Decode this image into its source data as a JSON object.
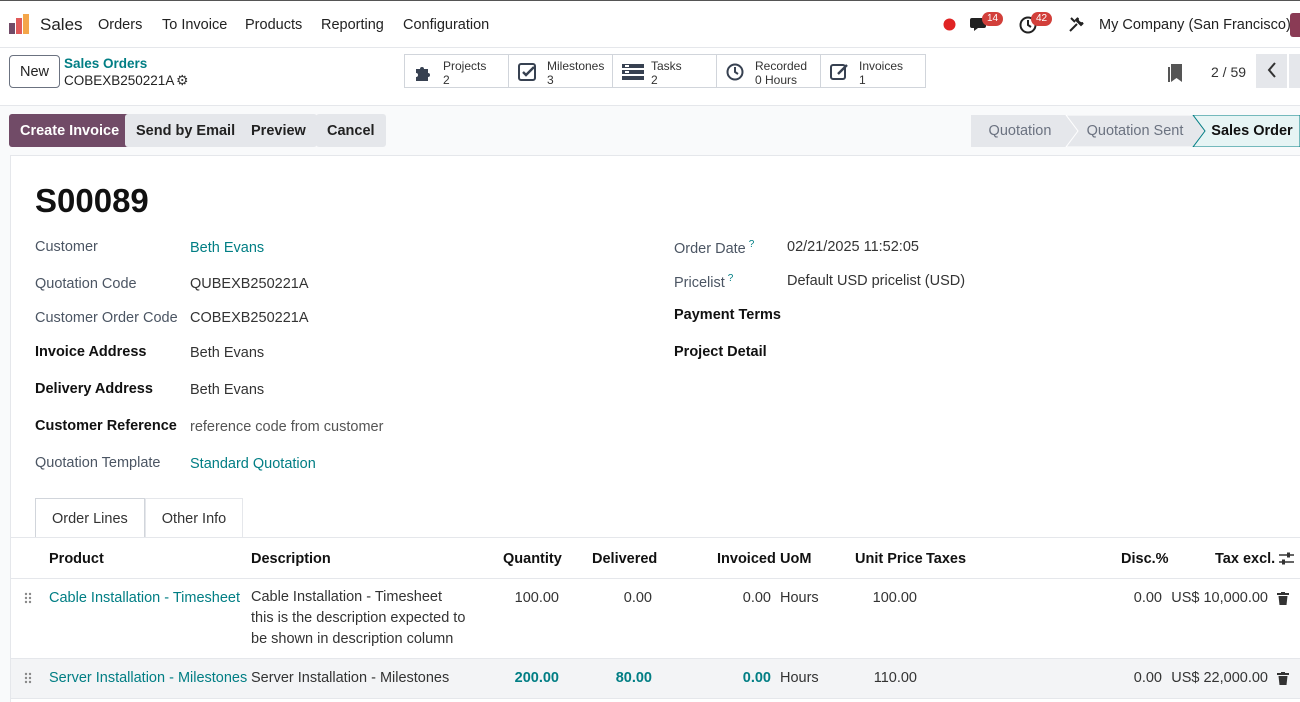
{
  "topnav": {
    "app_name": "Sales",
    "menu": [
      "Orders",
      "To Invoice",
      "Products",
      "Reporting",
      "Configuration"
    ],
    "messages_count": "14",
    "activities_count": "42",
    "company": "My Company (San Francisco)"
  },
  "control": {
    "new_label": "New",
    "breadcrumb": "Sales Orders",
    "record_code": "COBEXB250221A",
    "smart_buttons": [
      {
        "label": "Projects",
        "value": "2",
        "icon": "puzzle-icon"
      },
      {
        "label": "Milestones",
        "value": "3",
        "icon": "check-square-icon"
      },
      {
        "label": "Tasks",
        "value": "2",
        "icon": "tasks-icon"
      },
      {
        "label": "Recorded",
        "value": "0 Hours",
        "icon": "clock-icon"
      },
      {
        "label": "Invoices",
        "value": "1",
        "icon": "invoice-edit-icon"
      }
    ],
    "pager": "2 / 59"
  },
  "actions": {
    "create_invoice": "Create Invoice",
    "send_email": "Send by Email",
    "preview": "Preview",
    "cancel": "Cancel"
  },
  "stages": [
    "Quotation",
    "Quotation Sent",
    "Sales Order"
  ],
  "form": {
    "title": "S00089",
    "left": [
      {
        "label": "Customer",
        "value": "Beth Evans"
      },
      {
        "label": "Quotation Code",
        "value": "QUBEXB250221A"
      },
      {
        "label": "Customer Order Code",
        "value": "COBEXB250221A"
      },
      {
        "label": "Invoice Address",
        "value": "Beth Evans"
      },
      {
        "label": "Delivery Address",
        "value": "Beth Evans"
      },
      {
        "label": "Customer Reference",
        "value": "reference code from customer"
      },
      {
        "label": "Quotation Template",
        "value": "Standard Quotation"
      }
    ],
    "right": [
      {
        "label": "Order Date",
        "value": "02/21/2025 11:52:05"
      },
      {
        "label": "Pricelist",
        "value": "Default USD pricelist (USD)"
      },
      {
        "label": "Payment Terms",
        "value": ""
      },
      {
        "label": "Project Detail",
        "value": ""
      }
    ],
    "help_mark": "?"
  },
  "tabs": [
    "Order Lines",
    "Other Info"
  ],
  "table": {
    "headers": [
      "Product",
      "Description",
      "Quantity",
      "Delivered",
      "Invoiced",
      "UoM",
      "Unit Price",
      "Taxes",
      "Disc.%",
      "Tax excl."
    ],
    "rows": [
      {
        "product": "Cable Installation - Timesheet",
        "description": [
          "Cable Installation - Timesheet",
          "this is the description expected to",
          "be shown in description column"
        ],
        "quantity": "100.00",
        "delivered": "0.00",
        "invoiced": "0.00",
        "uom": "Hours",
        "unit_price": "100.00",
        "taxes": "",
        "discount": "0.00",
        "subtotal": "US$ 10,000.00"
      },
      {
        "product": "Server Installation - Milestones",
        "description": [
          "Server Installation - Milestones"
        ],
        "quantity": "200.00",
        "delivered": "80.00",
        "invoiced": "0.00",
        "uom": "Hours",
        "unit_price": "110.00",
        "taxes": "",
        "discount": "0.00",
        "subtotal": "US$ 22,000.00"
      }
    ]
  },
  "colors": {
    "brand": "#714b67",
    "link": "#017e84",
    "badge": "#d23f3a"
  }
}
